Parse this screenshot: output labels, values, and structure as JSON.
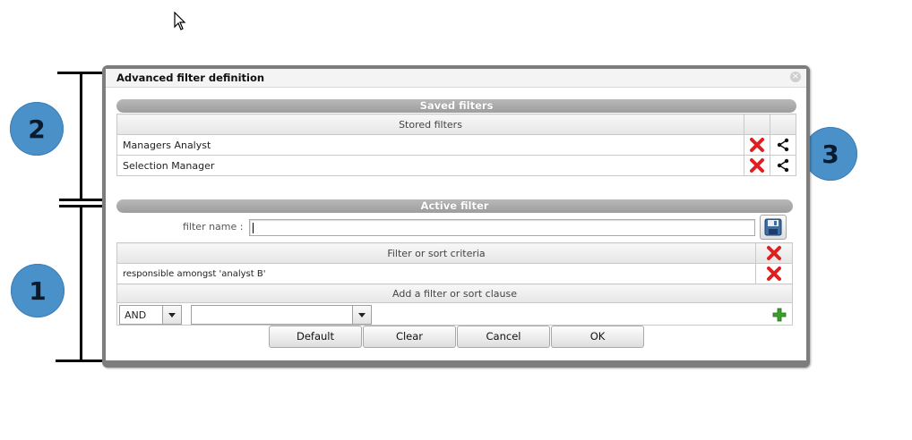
{
  "dialog": {
    "title": "Advanced filter definition",
    "close_icon": "close-circle-icon"
  },
  "callouts": [
    "2",
    "1",
    "3"
  ],
  "saved_filters": {
    "section_label": "Saved filters",
    "column_header": "Stored filters",
    "rows": [
      {
        "name": "Managers Analyst",
        "delete_icon": "red-x-icon",
        "share_icon": "share-icon"
      },
      {
        "name": "Selection Manager",
        "delete_icon": "red-x-icon",
        "share_icon": "share-icon"
      }
    ]
  },
  "active_filter": {
    "section_label": "Active filter",
    "name_label": "filter name :",
    "name_value": "",
    "save_icon": "floppy-disk-icon",
    "criteria_header": "Filter or sort criteria",
    "criteria_rows": [
      "responsible amongst 'analyst B'"
    ],
    "add_clause_header": "Add a filter or sort clause",
    "operator_value": "AND",
    "field_value": "",
    "add_icon": "green-plus-icon"
  },
  "buttons": {
    "default": "Default",
    "clear": "Clear",
    "cancel": "Cancel",
    "ok": "OK"
  },
  "colors": {
    "callout": "#4a90c9",
    "delete": "#e02020",
    "add": "#3aa22a",
    "section_bar": "#a8a8a8"
  }
}
